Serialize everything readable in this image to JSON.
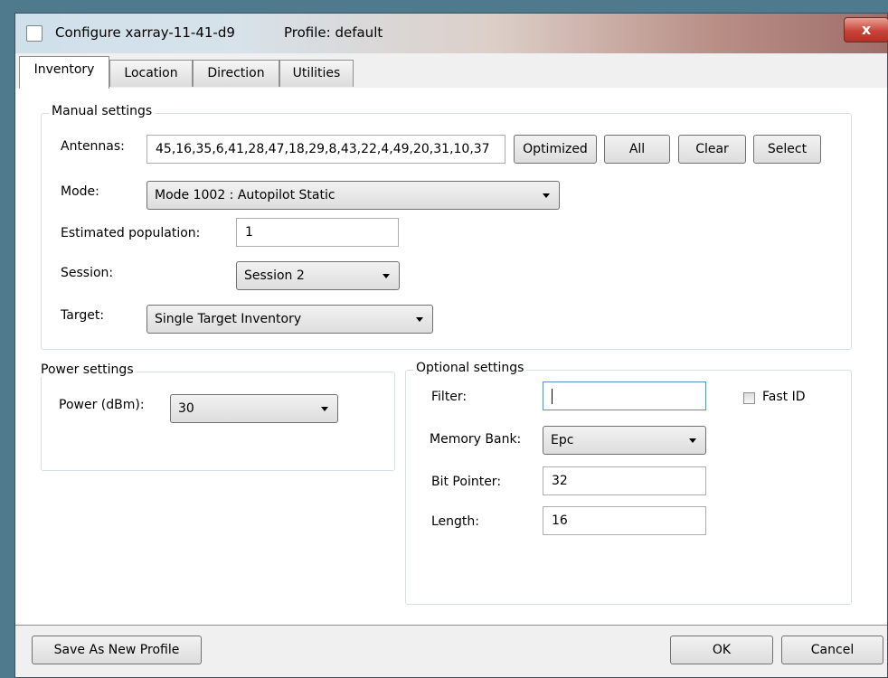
{
  "window": {
    "title": "Configure xarray-11-41-d9",
    "profile": "Profile: default",
    "close_label": "x"
  },
  "tabs": [
    {
      "label": "Inventory",
      "active": true
    },
    {
      "label": "Location",
      "active": false
    },
    {
      "label": "Direction",
      "active": false
    },
    {
      "label": "Utilities",
      "active": false
    }
  ],
  "manual": {
    "title": "Manual settings",
    "antennas_label": "Antennas:",
    "antennas_value": "45,16,35,6,41,28,47,18,29,8,43,22,4,49,20,31,10,37",
    "btn_optimized": "Optimized",
    "btn_all": "All",
    "btn_clear": "Clear",
    "btn_select": "Select",
    "mode_label": "Mode:",
    "mode_value": "Mode 1002 : Autopilot Static",
    "population_label": "Estimated population:",
    "population_value": "1",
    "session_label": "Session:",
    "session_value": "Session 2",
    "target_label": "Target:",
    "target_value": "Single Target Inventory"
  },
  "power": {
    "title": "Power settings",
    "label": "Power (dBm):",
    "value": "30"
  },
  "optional": {
    "title": "Optional settings",
    "filter_label": "Filter:",
    "filter_value": "",
    "fastid_label": "Fast ID",
    "fastid_checked": false,
    "memory_label": "Memory Bank:",
    "memory_value": "Epc",
    "bitpointer_label": "Bit Pointer:",
    "bitpointer_value": "32",
    "length_label": "Length:",
    "length_value": "16"
  },
  "footer": {
    "save_label": "Save As New Profile",
    "ok_label": "OK",
    "cancel_label": "Cancel"
  }
}
